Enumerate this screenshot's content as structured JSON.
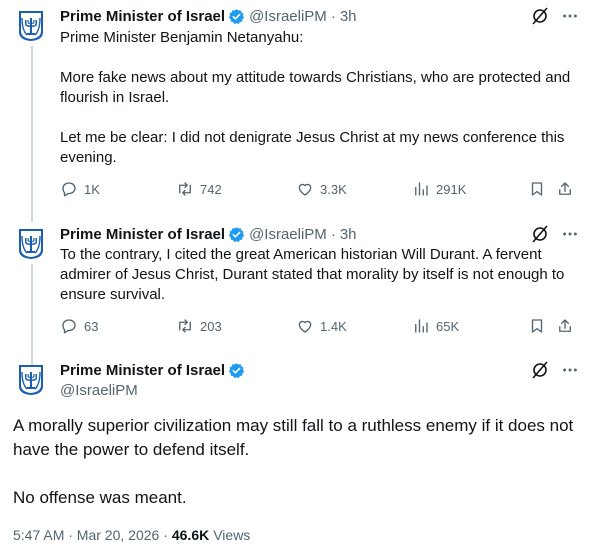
{
  "colors": {
    "accent": "#1d9bf0",
    "text": "#0f1419",
    "muted": "#536471",
    "emblem": "#1a5fae"
  },
  "tweets": [
    {
      "author": "Prime Minister of Israel",
      "handle": "@IsraeliPM",
      "sep": "·",
      "time": "3h",
      "paragraphs": [
        "Prime Minister Benjamin Netanyahu:",
        "More fake news about my attitude towards Christians, who are protected and flourish in Israel.",
        "Let me be clear: I did not denigrate Jesus Christ at my news conference this evening."
      ],
      "replies": "1K",
      "reposts": "742",
      "likes": "3.3K",
      "views": "291K"
    },
    {
      "author": "Prime Minister of Israel",
      "handle": "@IsraeliPM",
      "sep": "·",
      "time": "3h",
      "paragraphs": [
        "To the contrary, I cited the great American historian Will Durant. A fervent admirer of Jesus Christ, Durant stated that morality by itself is not enough to ensure survival."
      ],
      "replies": "63",
      "reposts": "203",
      "likes": "1.4K",
      "views": "65K"
    }
  ],
  "main": {
    "author": "Prime Minister of Israel",
    "handle": "@IsraeliPM",
    "paragraphs": [
      "A morally superior civilization may still fall to a ruthless enemy if it does not have the power to defend itself.",
      "No offense was meant."
    ],
    "timestamp": "5:47 AM · Mar 20, 2026 ·",
    "views_count": "46.6K",
    "views_label": "Views"
  },
  "icons": [
    "israel-emblem-icon",
    "verified-badge-icon",
    "grok-icon",
    "more-icon",
    "reply-icon",
    "repost-icon",
    "like-icon",
    "views-icon",
    "bookmark-icon",
    "share-icon"
  ]
}
